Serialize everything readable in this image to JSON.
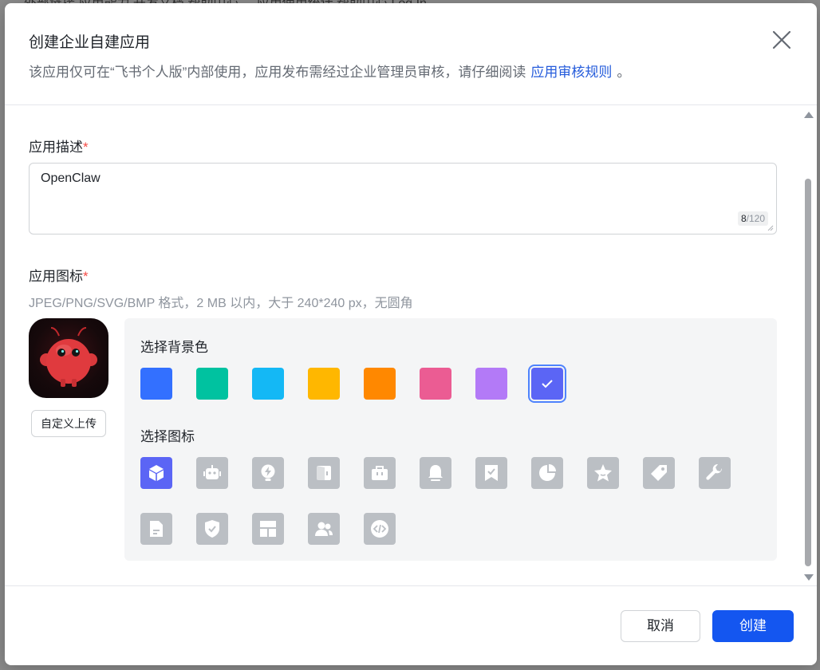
{
  "backdrop": {
    "text": "外部链接    应用能力    开发文档    帮助中心    ...    应用使用统计    帮助中心    Log In"
  },
  "dialog": {
    "title": "创建企业自建应用",
    "subtitle_prefix": "该应用仅可在“飞书个人版”内部使用，应用发布需经过企业管理员审核，请仔细阅读",
    "subtitle_link": "应用审核规则",
    "subtitle_suffix": "。"
  },
  "description": {
    "label": "应用描述",
    "required_mark": "*",
    "value": "OpenClaw",
    "count_current": "8",
    "count_max": "/120"
  },
  "icon_section": {
    "label": "应用图标",
    "required_mark": "*",
    "hint": "JPEG/PNG/SVG/BMP 格式，2 MB 以内，大于 240*240 px，无圆角",
    "upload_label": "自定义上传",
    "bg_title": "选择背景色",
    "icon_title": "选择图标",
    "bg_colors": [
      "#3370ff",
      "#00c2a0",
      "#14b8f5",
      "#ffb700",
      "#ff8800",
      "#eb5c93",
      "#b37af7",
      "#5b65f5"
    ],
    "selected_bg": 7,
    "icons": [
      "box-icon",
      "robot-icon",
      "lightning-bulb-icon",
      "door-icon",
      "briefcase-icon",
      "bell-icon",
      "bookmark-check-icon",
      "pie-chart-icon",
      "star-badge-icon",
      "tag-icon",
      "wrench-icon",
      "document-icon",
      "shield-check-icon",
      "layout-icon",
      "people-icon",
      "code-icon"
    ],
    "selected_icon": 0
  },
  "footer": {
    "cancel": "取消",
    "create": "创建"
  }
}
